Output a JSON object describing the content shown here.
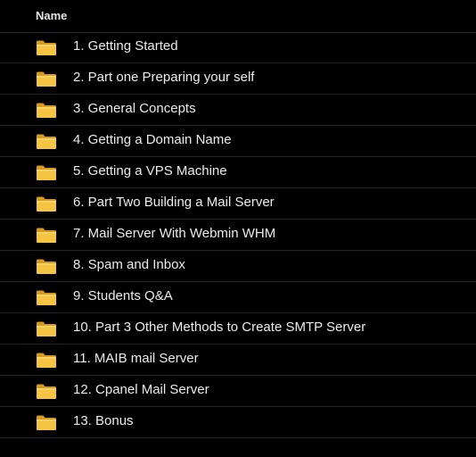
{
  "header": {
    "name_label": "Name"
  },
  "folder_icon_color": "#f6c443",
  "folder_icon_dark": "#d79a1e",
  "items": [
    {
      "label": "1. Getting Started",
      "icon": "folder-icon"
    },
    {
      "label": "2. Part one Preparing your self",
      "icon": "folder-icon"
    },
    {
      "label": "3. General Concepts",
      "icon": "folder-icon"
    },
    {
      "label": "4. Getting a Domain Name",
      "icon": "folder-icon"
    },
    {
      "label": "5. Getting a VPS Machine",
      "icon": "folder-icon"
    },
    {
      "label": "6. Part Two Building a Mail Server",
      "icon": "folder-icon"
    },
    {
      "label": "7. Mail Server With Webmin WHM",
      "icon": "folder-icon"
    },
    {
      "label": "8. Spam and Inbox",
      "icon": "folder-icon"
    },
    {
      "label": "9. Students Q&A",
      "icon": "folder-icon"
    },
    {
      "label": "10. Part 3 Other Methods to Create SMTP Server",
      "icon": "folder-icon"
    },
    {
      "label": "11. MAIB mail Server",
      "icon": "folder-icon"
    },
    {
      "label": "12. Cpanel Mail Server",
      "icon": "folder-icon"
    },
    {
      "label": "13. Bonus",
      "icon": "folder-icon"
    }
  ]
}
